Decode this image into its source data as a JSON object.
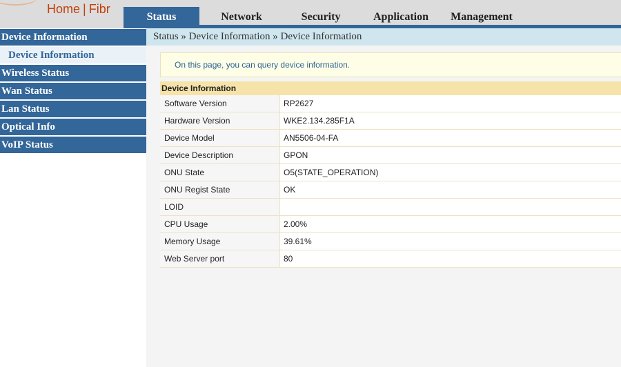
{
  "header": {
    "brand_home": "Home",
    "brand_sep": "|",
    "brand_name": "Fibr",
    "tabs": [
      {
        "label": "Status",
        "active": true
      },
      {
        "label": "Network",
        "active": false
      },
      {
        "label": "Security",
        "active": false
      },
      {
        "label": "Application",
        "active": false
      },
      {
        "label": "Management",
        "active": false
      }
    ]
  },
  "sidebar": {
    "items": [
      {
        "label": "Device Information"
      },
      {
        "label": "Device Information"
      },
      {
        "label": "Wireless Status"
      },
      {
        "label": "Wan Status"
      },
      {
        "label": "Lan Status"
      },
      {
        "label": "Optical Info"
      },
      {
        "label": "VoIP Status"
      }
    ]
  },
  "breadcrumb": "Status » Device Information » Device Information",
  "notice": "On this page, you can query device information.",
  "table": {
    "title": "Device Information",
    "rows": [
      {
        "label": "Software Version",
        "value": "RP2627"
      },
      {
        "label": "Hardware Version",
        "value": "WKE2.134.285F1A"
      },
      {
        "label": "Device Model",
        "value": "AN5506-04-FA"
      },
      {
        "label": "Device Description",
        "value": "GPON"
      },
      {
        "label": "ONU State",
        "value": "O5(STATE_OPERATION)"
      },
      {
        "label": "ONU Regist State",
        "value": "OK"
      },
      {
        "label": "LOID",
        "value": ""
      },
      {
        "label": "CPU Usage",
        "value": "2.00%"
      },
      {
        "label": "Memory Usage",
        "value": "39.61%"
      },
      {
        "label": "Web Server port",
        "value": "80"
      }
    ]
  },
  "colors": {
    "nav_blue": "#336699",
    "brand_orange": "#c2410c",
    "breadcrumb_bg": "#cfe6ee",
    "table_header_bg": "#f5e3a9"
  }
}
